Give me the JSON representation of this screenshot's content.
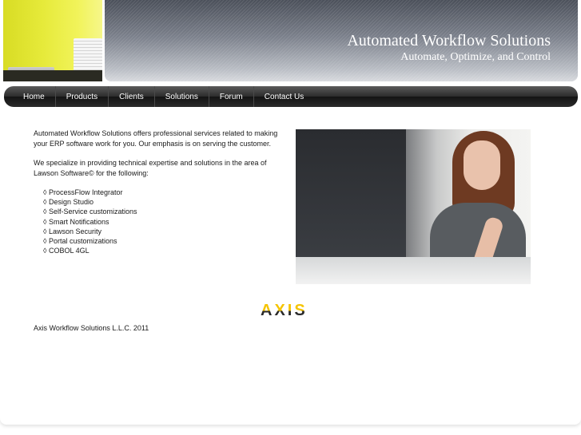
{
  "header": {
    "title": "Automated Workflow Solutions",
    "tagline": "Automate, Optimize, and Control"
  },
  "nav": {
    "items": [
      "Home",
      "Products",
      "Clients",
      "Solutions",
      "Forum",
      "Contact Us"
    ]
  },
  "main": {
    "intro_paragraph_1": "Automated Workflow Solutions offers professional services related to making your ERP software work for you.  Our emphasis is on serving the customer.",
    "intro_paragraph_2": "We specialize in providing technical expertise and solutions in the area of Lawson Software© for the following:",
    "services": [
      "◊ ProcessFlow Integrator",
      "◊ Design Studio",
      "◊ Self-Service customizations",
      "◊ Smart Notifications",
      "◊ Lawson Security",
      "◊ Portal customizations",
      "◊ COBOL 4GL"
    ]
  },
  "logo": {
    "text": "AXIS"
  },
  "footer": {
    "copyright": "Axis Workflow Solutions L.L.C. 2011"
  },
  "colors": {
    "accent_yellow": "#f5c400",
    "nav_background": "#2a2a2a",
    "header_gray": "#7b808b"
  }
}
